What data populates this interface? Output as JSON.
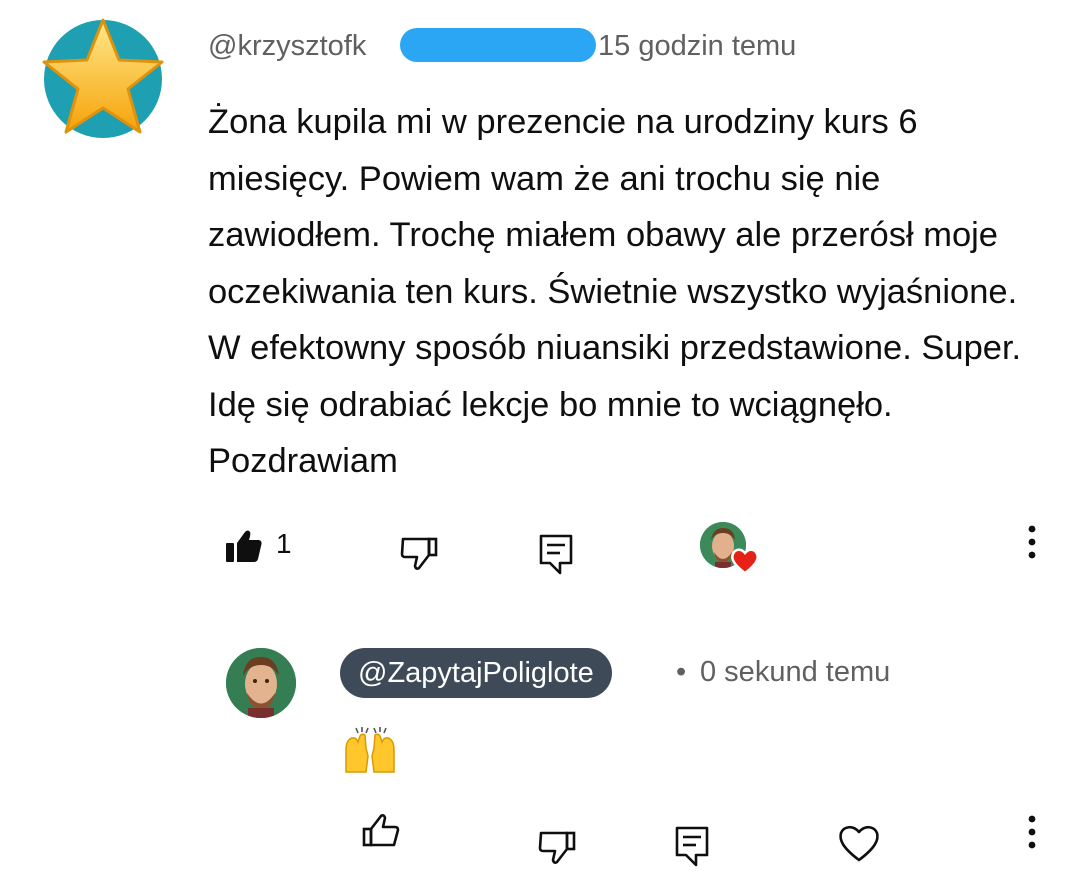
{
  "comment": {
    "username": "@krzysztofk",
    "time": "15 godzin temu",
    "text": "Żona kupila mi w prezencie na urodziny kurs 6 miesięcy. Powiem wam że ani trochu się nie zawiodłem. Trochę miałem obawy ale przerósł moje oczekiwania ten kurs. Świetnie wszystko wyjaśnione. W efektowny sposób niuansiki przedstawione. Super. Idę się odrabiać lekcje bo mnie to wciągnęło. Pozdrawiam",
    "like_count": "1",
    "avatar_icon": "star-icon",
    "redaction_color": "#2aa6f5"
  },
  "reply": {
    "username": "@ZapytajPoliglote",
    "separator": "•",
    "time": "0 sekund temu",
    "text_icon": "raising-hands-emoji",
    "chip_color": "#3e4a58"
  },
  "icons": {
    "liked": "thumbs-up-filled-icon",
    "dislike": "thumbs-down-icon",
    "reply": "reply-comment-icon",
    "heart": "heart-icon",
    "more": "more-vertical-icon"
  }
}
